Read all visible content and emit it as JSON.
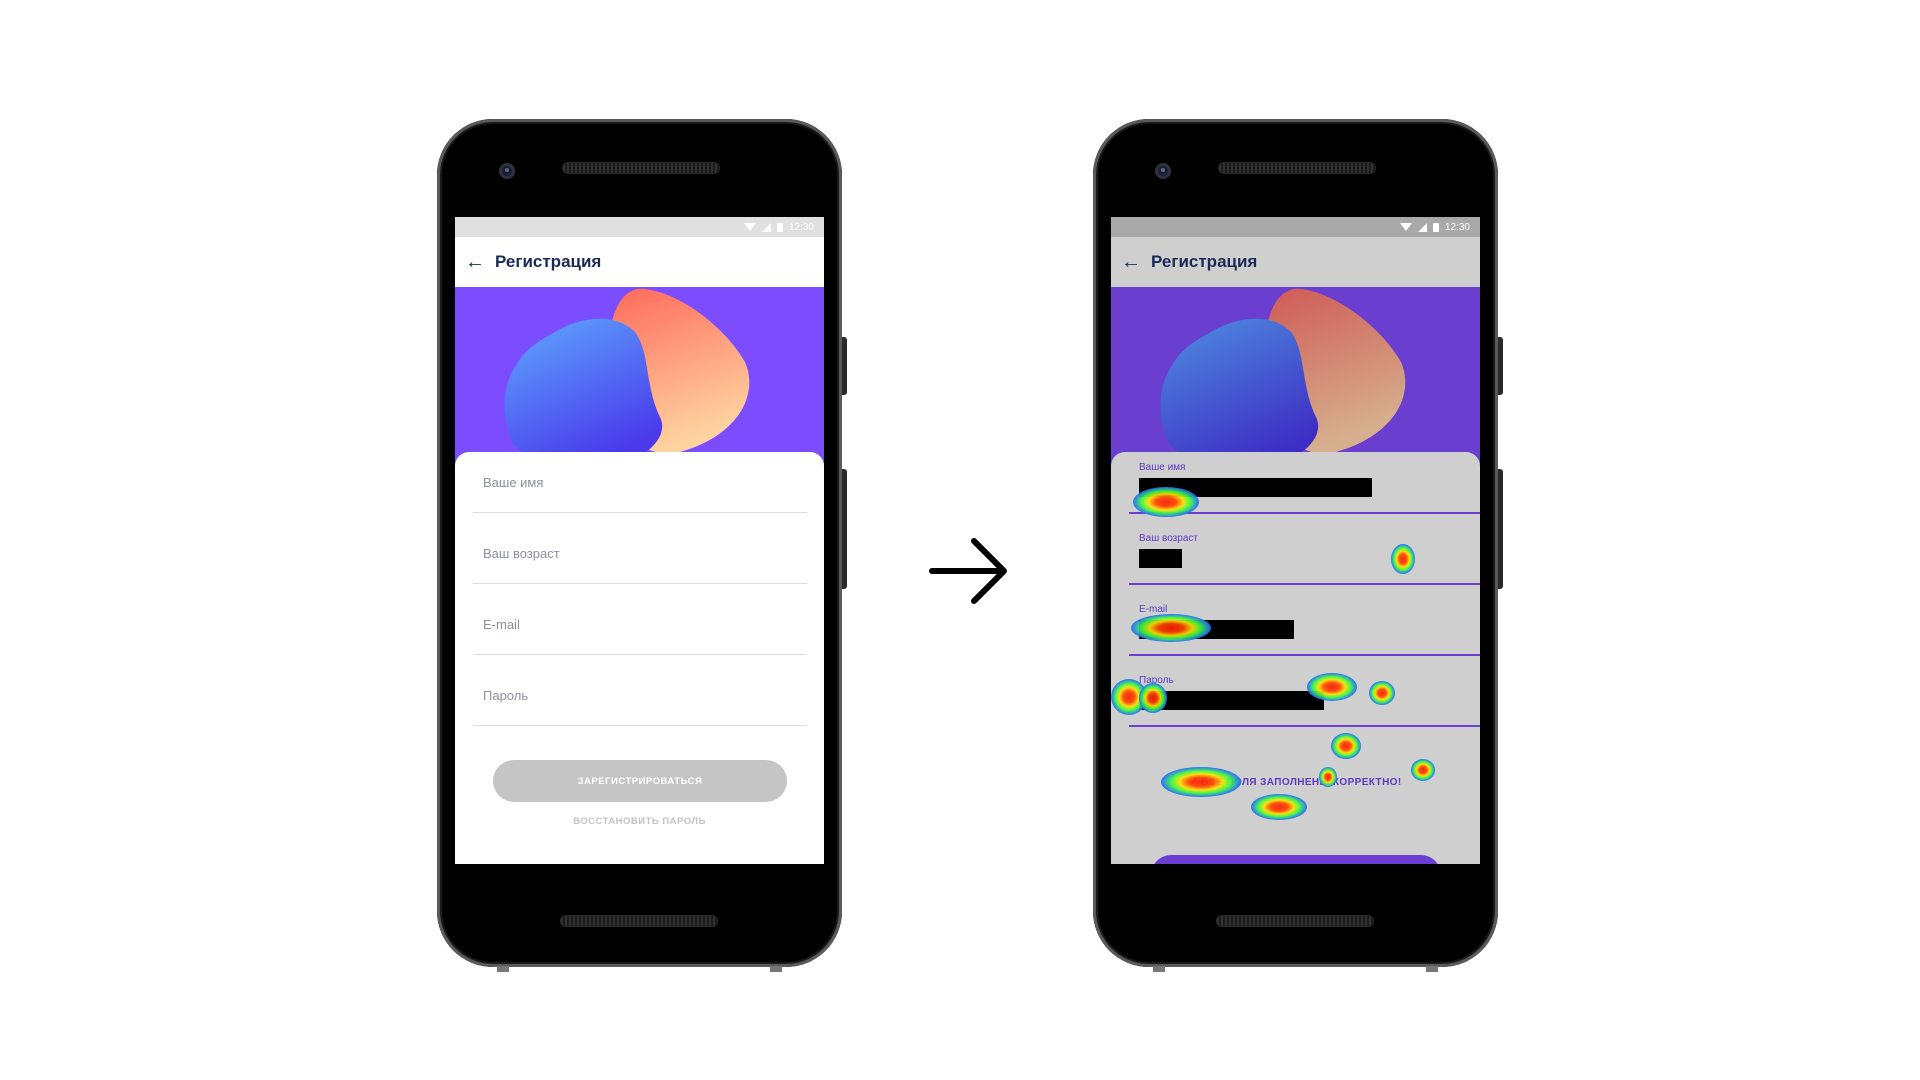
{
  "left_phone": {
    "status_time": "12:30",
    "appbar": {
      "back_icon": "arrow-left-icon",
      "title": "Регистрация"
    },
    "fields": [
      {
        "placeholder": "Ваше имя"
      },
      {
        "placeholder": "Ваш возраст"
      },
      {
        "placeholder": "E-mail"
      },
      {
        "placeholder": "Пароль"
      }
    ],
    "register_button": "ЗАРЕГИСТРИРОВАТЬСЯ",
    "restore_link": "ВОССТАНОВИТЬ ПАРОЛЬ"
  },
  "right_phone": {
    "status_time": "12:30",
    "appbar": {
      "back_icon": "arrow-left-icon",
      "title": "Регистрация"
    },
    "fields": [
      {
        "label": "Ваше имя"
      },
      {
        "label": "Ваш возраст"
      },
      {
        "label": "E-mail"
      },
      {
        "label": "Пароль"
      }
    ],
    "success_message": "✔ ВСЕ ПОЛЯ ЗАПОЛНЕНЫ КОРРЕКТНО!"
  },
  "transition_icon": "arrow-right-icon",
  "colors": {
    "accent_purple": "#7c4dff",
    "title_navy": "#1b2a55",
    "dim_overlay": "#cfcfcf"
  }
}
